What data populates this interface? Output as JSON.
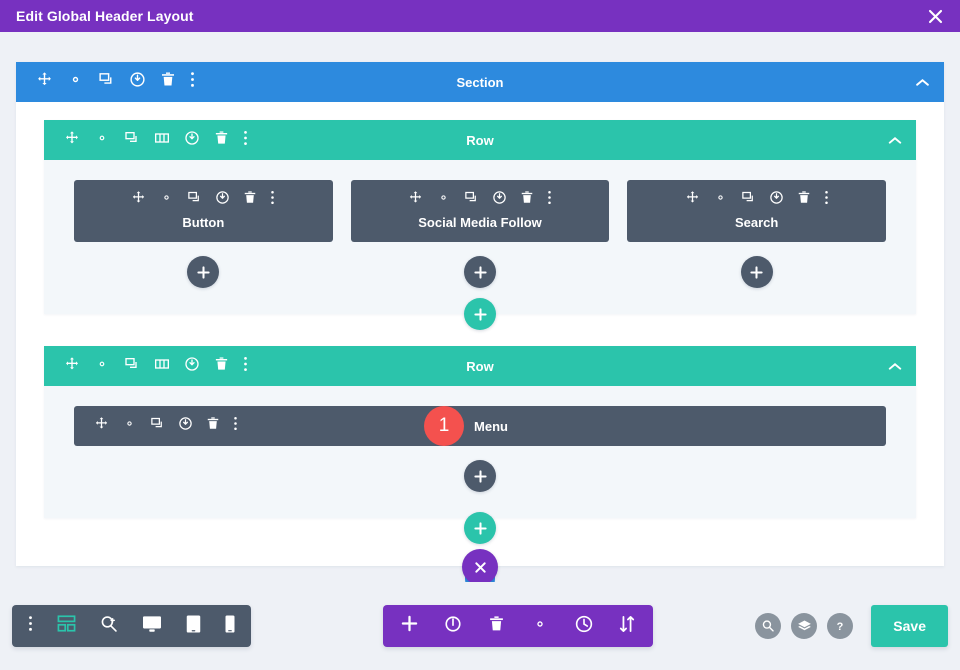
{
  "window": {
    "title": "Edit Global Header Layout",
    "close_icon": "close-icon"
  },
  "section": {
    "label": "Section",
    "color": "#2d8ade",
    "tools": [
      {
        "icon": "move-icon",
        "name": "move"
      },
      {
        "icon": "gear-icon",
        "name": "settings"
      },
      {
        "icon": "duplicate-icon",
        "name": "duplicate"
      },
      {
        "icon": "power-icon",
        "name": "disable"
      },
      {
        "icon": "trash-icon",
        "name": "delete"
      },
      {
        "icon": "ellipsis-vertical-icon",
        "name": "more"
      }
    ],
    "collapse_icon": "chevron-up-icon"
  },
  "rows": [
    {
      "label": "Row",
      "color": "#2bc4ab",
      "tools": [
        {
          "icon": "move-icon",
          "name": "move"
        },
        {
          "icon": "gear-icon",
          "name": "settings"
        },
        {
          "icon": "duplicate-icon",
          "name": "duplicate"
        },
        {
          "icon": "columns-icon",
          "name": "column-structure"
        },
        {
          "icon": "power-icon",
          "name": "disable"
        },
        {
          "icon": "trash-icon",
          "name": "delete"
        },
        {
          "icon": "ellipsis-vertical-icon",
          "name": "more"
        }
      ],
      "collapse_icon": "chevron-up-icon",
      "columns": [
        {
          "module": {
            "label": "Button",
            "badge": null
          }
        },
        {
          "module": {
            "label": "Social Media Follow",
            "badge": null
          }
        },
        {
          "module": {
            "label": "Search",
            "badge": null
          }
        }
      ]
    },
    {
      "label": "Row",
      "color": "#2bc4ab",
      "tools": [
        {
          "icon": "move-icon",
          "name": "move"
        },
        {
          "icon": "gear-icon",
          "name": "settings"
        },
        {
          "icon": "duplicate-icon",
          "name": "duplicate"
        },
        {
          "icon": "columns-icon",
          "name": "column-structure"
        },
        {
          "icon": "power-icon",
          "name": "disable"
        },
        {
          "icon": "trash-icon",
          "name": "delete"
        },
        {
          "icon": "ellipsis-vertical-icon",
          "name": "more"
        }
      ],
      "collapse_icon": "chevron-up-icon",
      "columns": [
        {
          "module": {
            "label": "Menu",
            "badge": "1",
            "badge_color": "#f4514e"
          }
        }
      ]
    }
  ],
  "add_buttons": {
    "add_module": "+",
    "add_row": "+",
    "close_section": "×"
  },
  "toolbars": {
    "left": {
      "items": [
        {
          "icon": "ellipsis-vertical-icon",
          "name": "builder-menu"
        },
        {
          "icon": "wireframe-icon",
          "name": "wireframe-view",
          "color": "#2bc4ab"
        },
        {
          "icon": "zoom-out-icon",
          "name": "zoom-view"
        },
        {
          "icon": "desktop-icon",
          "name": "desktop-view"
        },
        {
          "icon": "tablet-icon",
          "name": "tablet-view"
        },
        {
          "icon": "phone-icon",
          "name": "phone-view"
        }
      ]
    },
    "center": {
      "items": [
        {
          "icon": "plus-icon",
          "name": "add-section"
        },
        {
          "icon": "power-icon",
          "name": "toggle-builder"
        },
        {
          "icon": "trash-icon",
          "name": "clear-layout"
        },
        {
          "icon": "gear-icon",
          "name": "page-settings"
        },
        {
          "icon": "history-icon",
          "name": "editing-history"
        },
        {
          "icon": "sort-arrows-icon",
          "name": "portability"
        }
      ]
    },
    "right": {
      "items": [
        {
          "icon": "zoom-out-icon",
          "name": "search"
        },
        {
          "icon": "layers-icon",
          "name": "layers"
        },
        {
          "icon": "question-icon",
          "name": "help"
        }
      ],
      "save_label": "Save",
      "save_color": "#2bc4ab"
    }
  }
}
